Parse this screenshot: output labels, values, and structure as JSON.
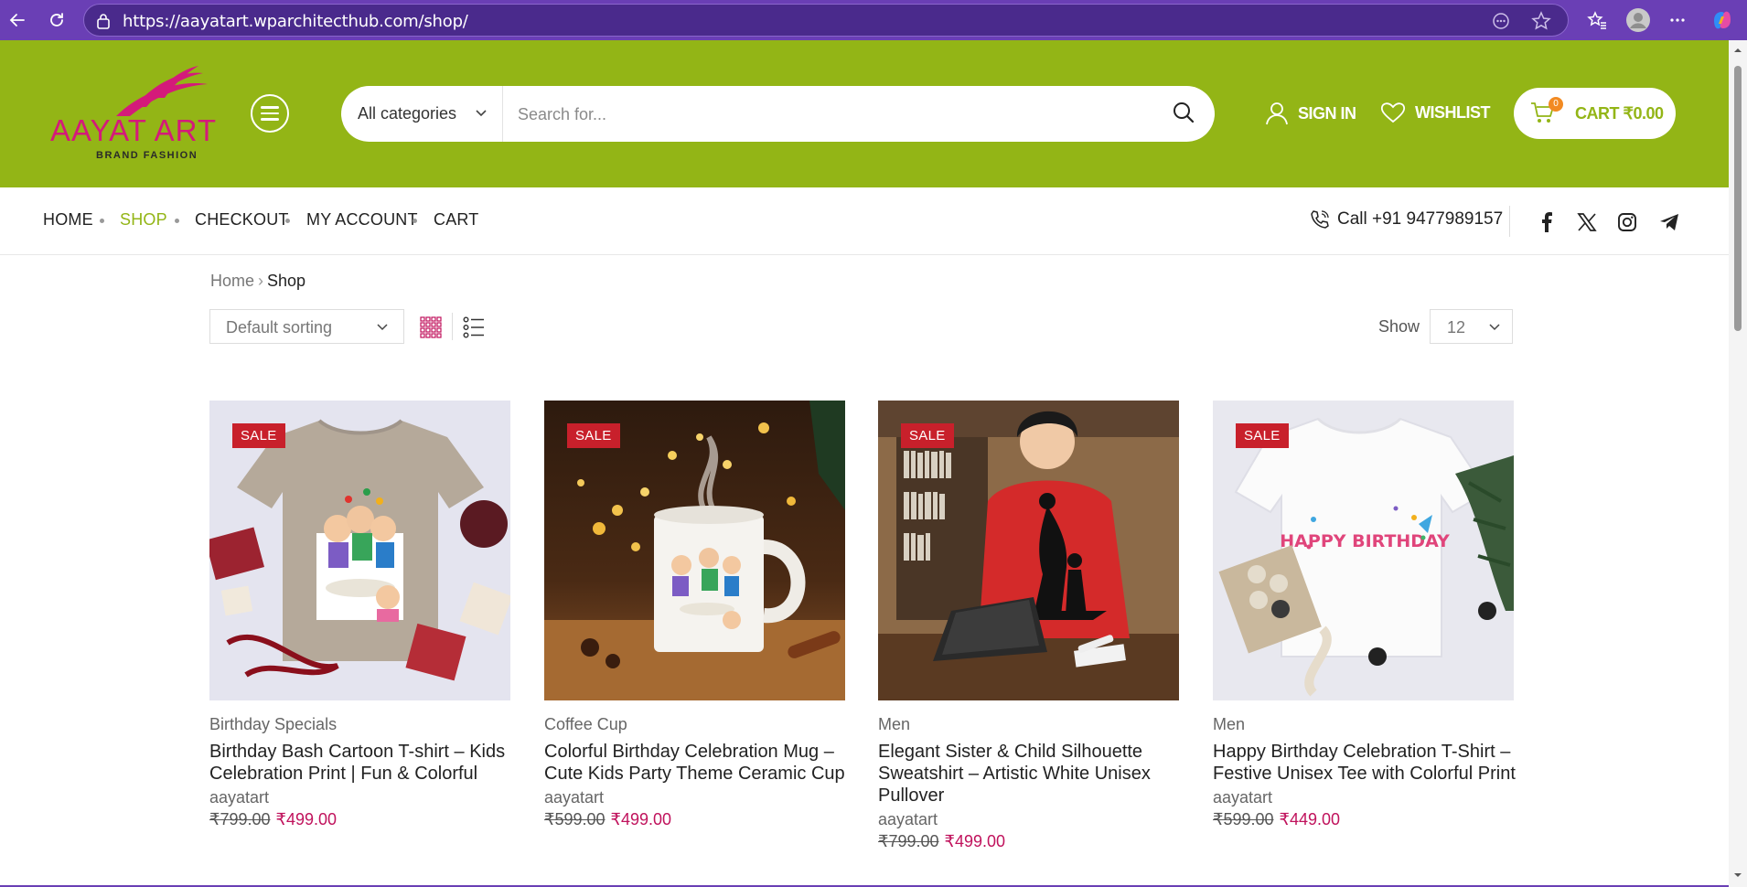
{
  "browser": {
    "url": "https://aayatart.wparchitecthub.com/shop/"
  },
  "header": {
    "logo_main": "AAYAT ART",
    "logo_sub": "BRAND FASHION",
    "brand_color": "#93b516",
    "logo_color": "#d41a7a",
    "search": {
      "category": "All categories",
      "placeholder": "Search for..."
    },
    "sign_in": "SIGN IN",
    "wishlist": "WISHLIST",
    "cart_label": "CART ₹0.00",
    "cart_count": "0"
  },
  "nav": {
    "items": [
      "HOME",
      "SHOP",
      "CHECKOUT",
      "MY ACCOUNT",
      "CART"
    ],
    "active": "SHOP",
    "phone": "Call +91 9477989157",
    "social": [
      "facebook-icon",
      "x-twitter-icon",
      "instagram-icon",
      "telegram-icon"
    ]
  },
  "shop": {
    "breadcrumb": {
      "home": "Home",
      "current": "Shop"
    },
    "sorting": "Default sorting",
    "show_label": "Show",
    "show_value": "12"
  },
  "products": [
    {
      "badge": "SALE",
      "category": "Birthday Specials",
      "title": "Birthday Bash Cartoon T-shirt – Kids Celebration Print | Fun & Colorful",
      "vendor": "aayatart",
      "old_price": "₹799.00",
      "new_price": "₹499.00"
    },
    {
      "badge": "SALE",
      "category": "Coffee Cup",
      "title": "Colorful Birthday Celebration Mug – Cute Kids Party Theme Ceramic Cup",
      "vendor": "aayatart",
      "old_price": "₹599.00",
      "new_price": "₹499.00"
    },
    {
      "badge": "SALE",
      "category": "Men",
      "title": "Elegant Sister & Child Silhouette Sweatshirt – Artistic White Unisex Pullover",
      "vendor": "aayatart",
      "old_price": "₹799.00",
      "new_price": "₹499.00"
    },
    {
      "badge": "SALE",
      "category": "Men",
      "title": "Happy Birthday Celebration T-Shirt – Festive Unisex Tee with Colorful Print",
      "vendor": "aayatart",
      "old_price": "₹599.00",
      "new_price": "₹449.00",
      "print_text": "HAPPY BIRTHDAY"
    }
  ]
}
